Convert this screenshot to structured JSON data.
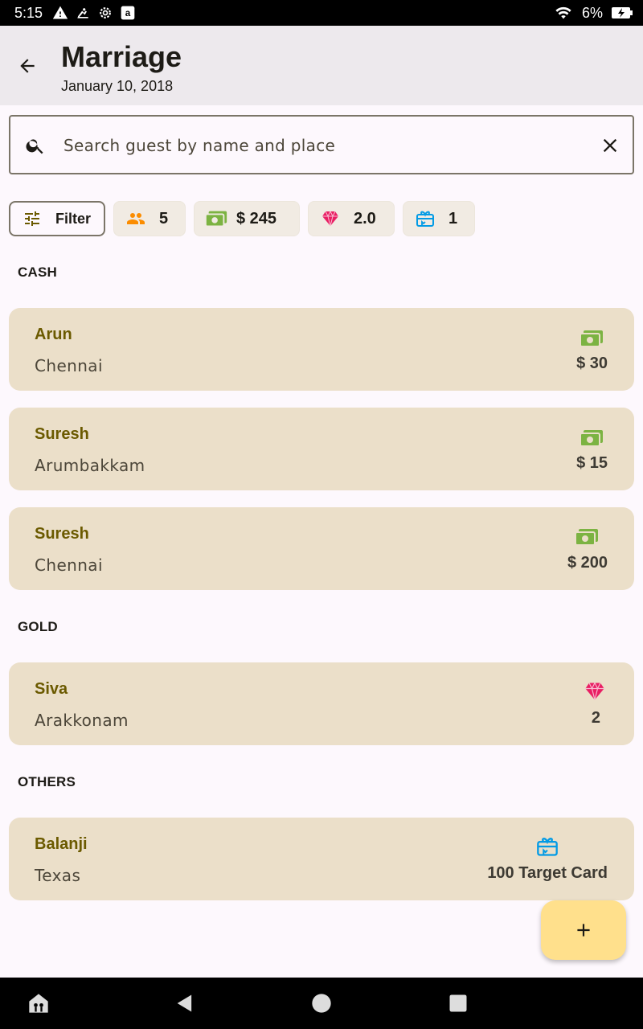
{
  "status_bar": {
    "time": "5:15",
    "battery": "6%"
  },
  "app_bar": {
    "title": "Marriage",
    "subtitle": "January 10, 2018"
  },
  "search": {
    "placeholder": "Search guest by name and place"
  },
  "chips": {
    "filter_label": "Filter",
    "guests": "5",
    "cash": "$ 245",
    "gold": "2.0",
    "gifts": "1"
  },
  "sections": {
    "cash": {
      "label": "CASH",
      "items": [
        {
          "name": "Arun",
          "place": "Chennai",
          "value": "$ 30",
          "icon": "cash-icon"
        },
        {
          "name": "Suresh",
          "place": "Arumbakkam",
          "value": "$ 15",
          "icon": "cash-icon"
        },
        {
          "name": "Suresh",
          "place": "Chennai",
          "value": "$ 200",
          "icon": "cash-icon"
        }
      ]
    },
    "gold": {
      "label": "GOLD",
      "items": [
        {
          "name": "Siva",
          "place": "Arakkonam",
          "value": "2",
          "icon": "diamond-icon"
        }
      ]
    },
    "others": {
      "label": "OTHERS",
      "items": [
        {
          "name": "Balanji",
          "place": "Texas",
          "value": "100 Target Card",
          "icon": "gift-card-icon"
        }
      ]
    }
  },
  "colors": {
    "accent": "#ffe08c",
    "card": "#ebdfc9",
    "name_text": "#6b5a00",
    "cash_green": "#7cb342",
    "gold_pink": "#e91e63",
    "gift_blue": "#039be5",
    "people_orange": "#fb8c00"
  }
}
